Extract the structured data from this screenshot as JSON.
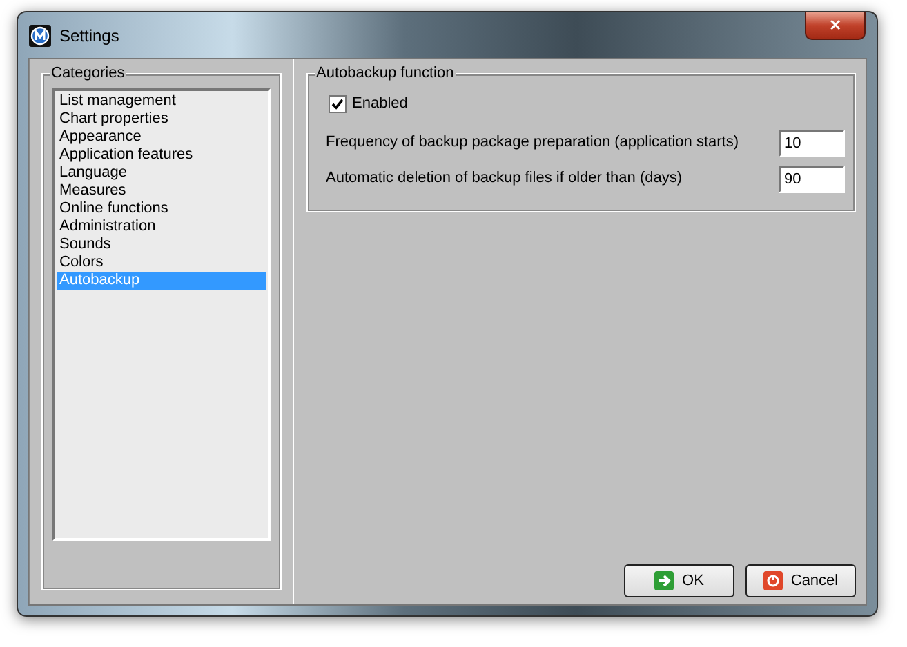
{
  "window": {
    "title": "Settings",
    "close": "✕"
  },
  "categories": {
    "title": "Categories",
    "items": [
      {
        "label": "List management",
        "selected": false
      },
      {
        "label": "Chart properties",
        "selected": false
      },
      {
        "label": "Appearance",
        "selected": false
      },
      {
        "label": "Application features",
        "selected": false
      },
      {
        "label": "Language",
        "selected": false
      },
      {
        "label": "Measures",
        "selected": false
      },
      {
        "label": "Online functions",
        "selected": false
      },
      {
        "label": "Administration",
        "selected": false
      },
      {
        "label": "Sounds",
        "selected": false
      },
      {
        "label": "Colors",
        "selected": false
      },
      {
        "label": "Autobackup",
        "selected": true
      }
    ]
  },
  "autobackup": {
    "title": "Autobackup function",
    "enabled": {
      "label": "Enabled",
      "checked": true
    },
    "fields": [
      {
        "label": "Frequency of backup package preparation (application starts)",
        "value": "10"
      },
      {
        "label": "Automatic deletion of backup files if older than (days)",
        "value": "90"
      }
    ]
  },
  "buttons": [
    {
      "kind": "ok",
      "label": "OK"
    },
    {
      "kind": "cancel",
      "label": "Cancel"
    }
  ]
}
